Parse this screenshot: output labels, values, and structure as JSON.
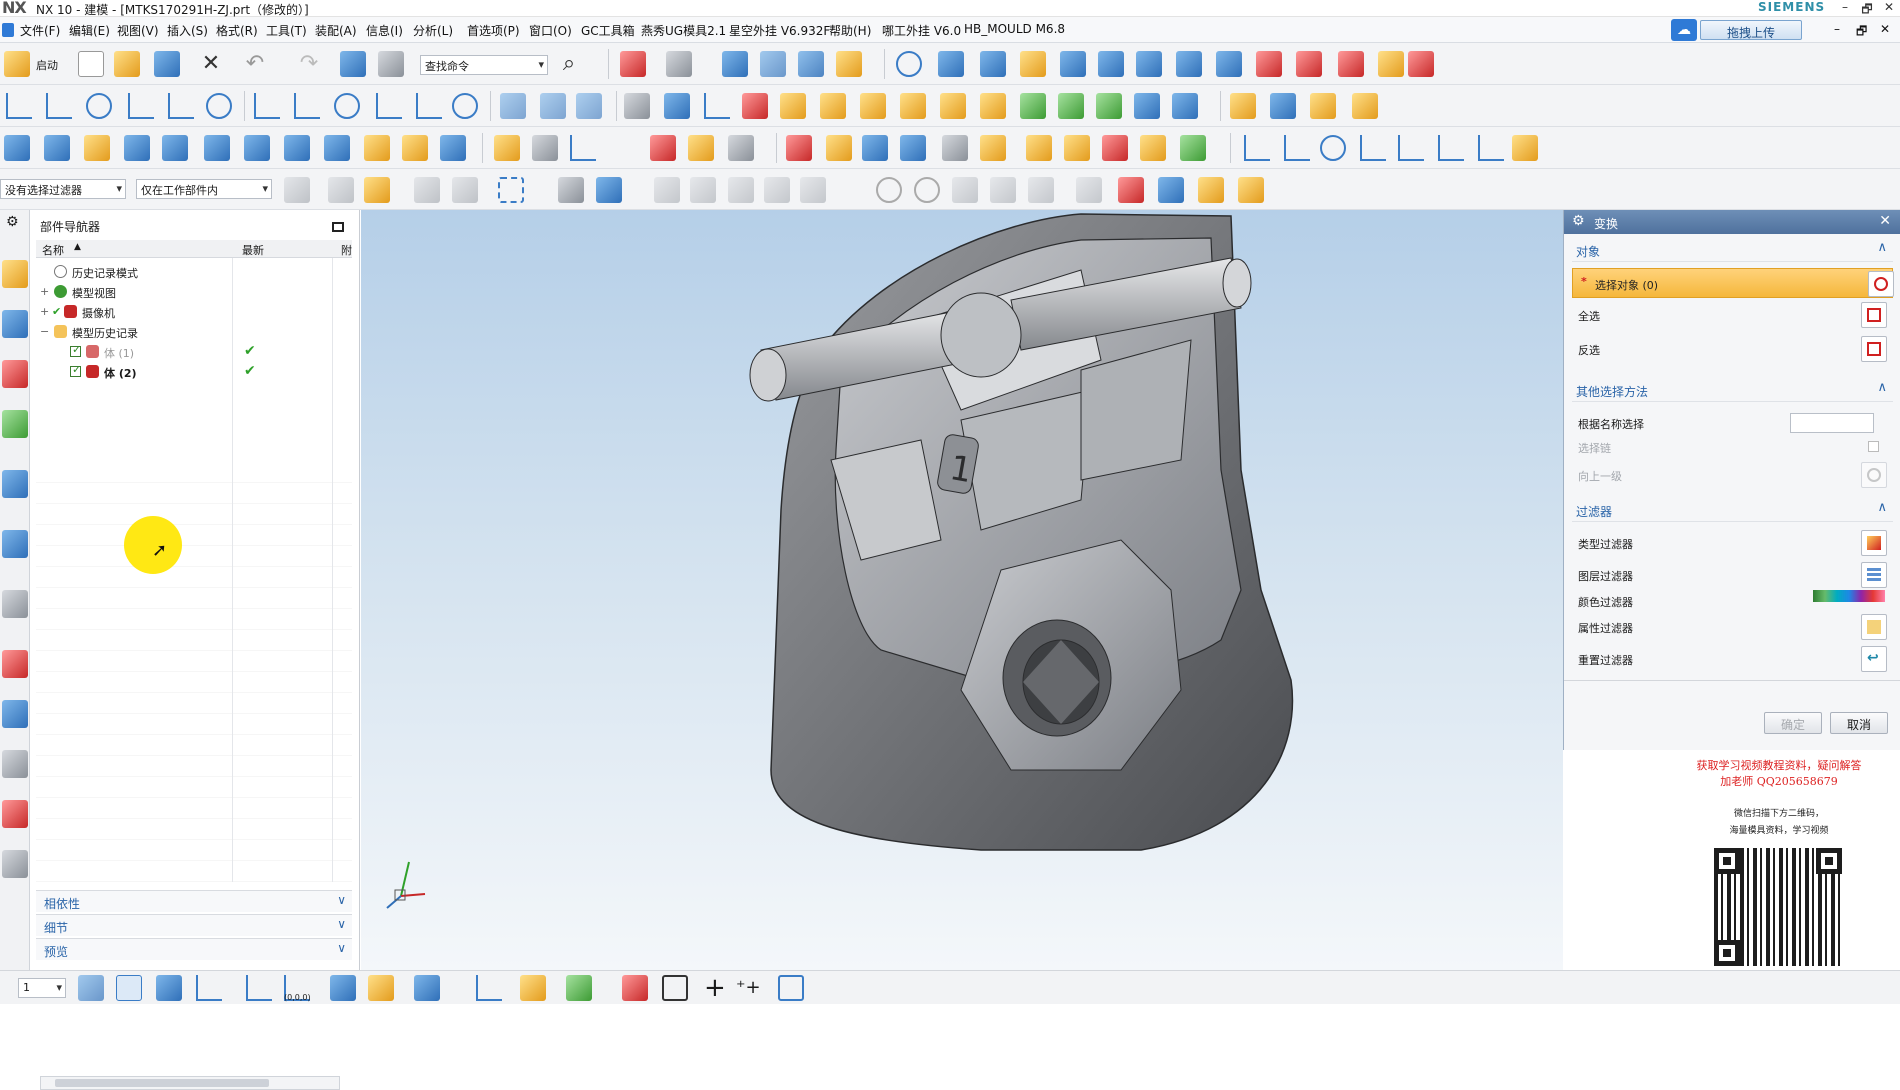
{
  "titlebar": {
    "app_logo": "NX",
    "title": "NX 10 - 建模 - [MTKS170291H-ZJ.prt（修改的）]",
    "brand": "SIEMENS",
    "window_controls": [
      "–",
      "🗗",
      "✕"
    ]
  },
  "menubar": {
    "items": [
      "文件(F)",
      "编辑(E)",
      "视图(V)",
      "插入(S)",
      "格式(R)",
      "工具(T)",
      "装配(A)",
      "信息(I)",
      "分析(L)",
      "首选项(P)",
      "窗口(O)",
      "GC工具箱",
      "燕秀UG模具2.1",
      "星空外挂 V6.932F",
      "帮助(H)",
      "哪工外挂 V6.0",
      "HB_MOULD M6.8"
    ],
    "upload_button": "拖拽上传",
    "inner_controls": [
      "–",
      "🗗",
      "✕"
    ]
  },
  "toolbar": {
    "start_label": "启动",
    "search_placeholder": "查找命令",
    "filter_combo": "没有选择过滤器",
    "scope_combo": "仅在工作部件内"
  },
  "navigator": {
    "title": "部件导航器",
    "col_name": "名称",
    "col_latest": "最新",
    "col_extra": "附",
    "rows": [
      {
        "label": "历史记录模式",
        "level": 1
      },
      {
        "label": "模型视图",
        "level": 1
      },
      {
        "label": "摄像机",
        "level": 1
      },
      {
        "label": "模型历史记录",
        "level": 1
      },
      {
        "label": "体 (1)",
        "level": 2,
        "ok": "✔"
      },
      {
        "label": "体 (2)",
        "level": 2,
        "ok": "✔"
      }
    ],
    "panels": [
      "相依性",
      "细节",
      "预览"
    ]
  },
  "dialog": {
    "title": "变换",
    "groups": {
      "object": "对象",
      "other": "其他选择方法",
      "filter": "过滤器"
    },
    "select_object": "选择对象 (0)",
    "select_all": "全选",
    "invert": "反选",
    "by_name": "根据名称选择",
    "select_chain": "选择链",
    "up_one_level": "向上一级",
    "type_filter": "类型过滤器",
    "layer_filter": "图层过滤器",
    "color_filter": "颜色过滤器",
    "attr_filter": "属性过滤器",
    "reset_filter": "重置过滤器",
    "ok": "确定",
    "cancel": "取消"
  },
  "ad": {
    "line1": "获取学习视频教程资料，疑问解答",
    "line2": "加老师 QQ205658679",
    "line3": "微信扫描下方二维码，",
    "line4": "海量模具资料，学习视频"
  },
  "bottombar": {
    "layer_value": "1"
  },
  "part_label": "1",
  "triad_label": "(0,0,0)"
}
